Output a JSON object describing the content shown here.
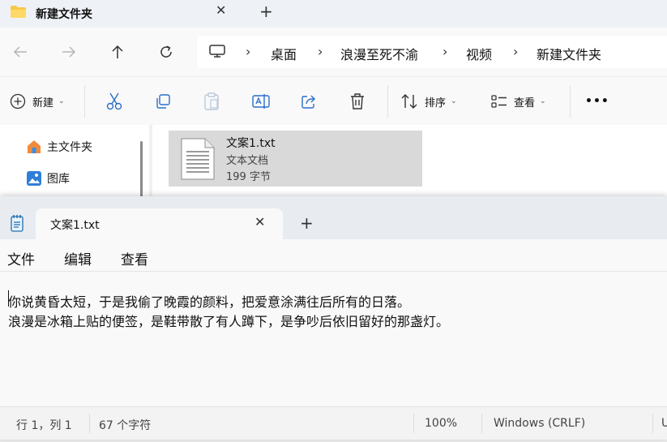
{
  "explorer": {
    "tab_title": "新建文件夹",
    "tab_close": "✕",
    "new_tab": "+",
    "breadcrumb": [
      "桌面",
      "浪漫至死不渝",
      "视频",
      "新建文件夹"
    ],
    "breadcrumb_sep": "›",
    "toolbar": {
      "new_label": "新建",
      "sort_label": "排序",
      "view_label": "查看",
      "more_label": "•••"
    },
    "sidebar": {
      "items": [
        {
          "label": "主文件夹",
          "icon": "home-icon"
        },
        {
          "label": "图库",
          "icon": "gallery-icon"
        }
      ]
    },
    "file": {
      "name": "文案1.txt",
      "type": "文本文档",
      "size": "199 字节"
    }
  },
  "notepad": {
    "tab_title": "文案1.txt",
    "tab_close": "✕",
    "new_tab": "+",
    "menu": [
      "文件",
      "编辑",
      "查看"
    ],
    "lines": [
      "你说黄昏太短，于是我偷了晚霞的颜料，把爱意涂满往后所有的日落。",
      "浪漫是冰箱上贴的便签，是鞋带散了有人蹲下，是争吵后依旧留好的那盏灯。"
    ],
    "status": {
      "position": "行 1，列 1",
      "chars": "67 个字符",
      "zoom": "100%",
      "line_ending": "Windows (CRLF)",
      "encoding_peek": "U"
    }
  },
  "colors": {
    "accent": "#0067c0",
    "folder_yellow": "#f7c948",
    "selection": "#d9d9d9"
  }
}
